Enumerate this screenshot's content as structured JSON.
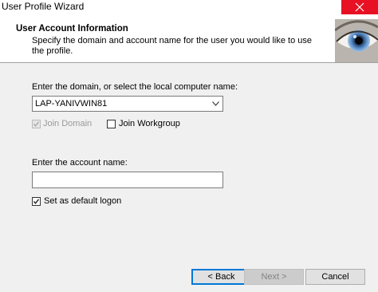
{
  "window": {
    "title": "User Profile Wizard"
  },
  "header": {
    "title": "User Account  Information",
    "description": "Specify the domain and account name for the user you would like to use the profile."
  },
  "domain": {
    "label": "Enter the domain, or select the local computer name:",
    "value": "LAP-YANIVWIN81"
  },
  "options": {
    "join_domain_label": "Join Domain",
    "join_domain_checked": true,
    "join_domain_enabled": false,
    "join_workgroup_label": "Join Workgroup",
    "join_workgroup_checked": false
  },
  "account": {
    "label": "Enter the account name:",
    "value": ""
  },
  "default_logon": {
    "label": "Set as default logon",
    "checked": true
  },
  "buttons": {
    "back": "< Back",
    "next": "Next >",
    "cancel": "Cancel"
  },
  "colors": {
    "close_button": "#e81123",
    "body_background": "#f0f0f0",
    "default_button_border": "#0078d7"
  },
  "icons": {
    "close": "close-icon",
    "header": "eye-icon",
    "dropdown": "chevron-down-icon",
    "check": "checkmark-icon"
  }
}
